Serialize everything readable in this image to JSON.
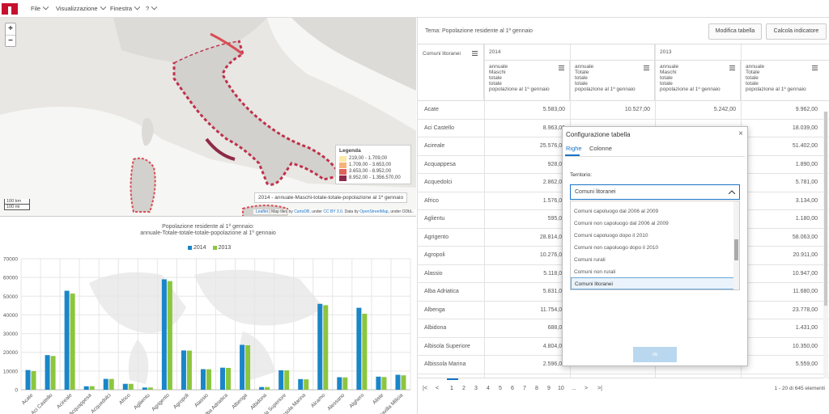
{
  "menu": {
    "items": [
      "File",
      "Visualizzazione",
      "Finestra",
      "?"
    ]
  },
  "map": {
    "zoom_in": "+",
    "zoom_out": "−",
    "legend_title": "Legenda",
    "legend": [
      {
        "label": "219,00 - 1.709,00",
        "color": "#fde9a8"
      },
      {
        "label": "1.709,00 - 3.653,00",
        "color": "#f7b27a"
      },
      {
        "label": "3.653,00 - 8.952,00",
        "color": "#e0625a"
      },
      {
        "label": "8.952,00 - 1.356.570,00",
        "color": "#8e2a4a"
      }
    ],
    "caption": "2014 - annuale-Maschi-totale-totale-popolazione al 1º gennaio",
    "scale_km": "100 km",
    "scale_mi": "100 mi",
    "attribution": {
      "leaflet": "Leaflet",
      "t1": " | Map tiles by ",
      "cartodb": "CartoDB",
      "t2": ", under ",
      "cc": "CC BY 3.0",
      "t3": ". Data by ",
      "osm": "OpenStreetMap",
      "t4": ", under ODbL."
    }
  },
  "chart": {
    "title_line1": "Popolazione residente al 1º gennaio:",
    "title_line2": "annuale-Totale-totale-totale-popolazione al 1º gennaio"
  },
  "chart_data": {
    "type": "bar",
    "title": "Popolazione residente al 1º gennaio: annuale-Totale-totale-totale-popolazione al 1º gennaio",
    "categories": [
      "Acate",
      "Aci Castello",
      "Acireale",
      "Acquappesa",
      "Acquedolci",
      "Africo",
      "Agliientu",
      "Agrigento",
      "Agropoli",
      "Alassio",
      "Alba Adriatica",
      "Albenga",
      "Albidona",
      "Albisola Superiore",
      "Albissola Marina",
      "Alcamo",
      "Alessano",
      "Alghero",
      "Aliste",
      "Altavilla Milicia"
    ],
    "series": [
      {
        "name": "2014",
        "color": "#1a86c8",
        "values": [
          10527,
          18500,
          52900,
          1850,
          5800,
          3150,
          1180,
          59000,
          21000,
          11000,
          11800,
          24000,
          1450,
          10400,
          5700,
          45900,
          6700,
          43800,
          7000,
          8000
        ]
      },
      {
        "name": "2013",
        "color": "#8cc63f",
        "values": [
          9962,
          18039,
          51402,
          1890,
          5781,
          3134,
          1180,
          58063,
          20911,
          10947,
          11680,
          23778,
          1431,
          10350,
          5559,
          45200,
          6600,
          40600,
          6800,
          7700
        ]
      }
    ],
    "ylim": [
      0,
      70000
    ],
    "yticks": [
      0,
      10000,
      20000,
      30000,
      40000,
      50000,
      60000,
      70000
    ],
    "grid": true,
    "legend_position": "top"
  },
  "panel": {
    "tema": "Tema: Popolazione residente al 1º gennaio",
    "btn_modifica": "Modifica tabella",
    "btn_calcola": "Calcola indicatore"
  },
  "table": {
    "row_header": "Comuni litoranei",
    "years": [
      "2014",
      "2013"
    ],
    "col_headers": [
      [
        "annuale",
        "Maschi",
        "totale",
        "totale",
        "popolazione al 1º gennaio"
      ],
      [
        "annuale",
        "Totale",
        "totale",
        "totale",
        "popolazione al 1º gennaio"
      ],
      [
        "annuale",
        "Maschi",
        "totale",
        "totale",
        "popolazione al 1º gennaio"
      ],
      [
        "annuale",
        "Totale",
        "totale",
        "totale",
        "popolazione al 1º gennaio"
      ]
    ],
    "rows": [
      {
        "name": "Acate",
        "v": [
          "5.583,00",
          "10.527,00",
          "5.242,00",
          "9.962,00"
        ]
      },
      {
        "name": "Aci Castello",
        "v": [
          "8.963,00",
          "",
          "",
          "18.039,00"
        ]
      },
      {
        "name": "Acireale",
        "v": [
          "25.576,00",
          "",
          "",
          "51.402,00"
        ]
      },
      {
        "name": "Acquappesa",
        "v": [
          "928,00",
          "",
          "",
          "1.890,00"
        ]
      },
      {
        "name": "Acquedolci",
        "v": [
          "2.862,00",
          "",
          "",
          "5.781,00"
        ]
      },
      {
        "name": "Africo",
        "v": [
          "1.576,00",
          "",
          "",
          "3.134,00"
        ]
      },
      {
        "name": "Aglientu",
        "v": [
          "595,00",
          "",
          "",
          "1.180,00"
        ]
      },
      {
        "name": "Agrigento",
        "v": [
          "28.814,00",
          "",
          "",
          "58.063,00"
        ]
      },
      {
        "name": "Agropoli",
        "v": [
          "10.276,00",
          "",
          "",
          "20.911,00"
        ]
      },
      {
        "name": "Alassio",
        "v": [
          "5.118,00",
          "",
          "",
          "10.947,00"
        ]
      },
      {
        "name": "Alba Adriatica",
        "v": [
          "5.831,00",
          "",
          "",
          "11.680,00"
        ]
      },
      {
        "name": "Albenga",
        "v": [
          "11.754,00",
          "",
          "",
          "23.778,00"
        ]
      },
      {
        "name": "Albidona",
        "v": [
          "688,00",
          "",
          "",
          "1.431,00"
        ]
      },
      {
        "name": "Albisola Superiore",
        "v": [
          "4.804,00",
          "",
          "",
          "10.350,00"
        ]
      },
      {
        "name": "Albissola Marina",
        "v": [
          "2.596,00",
          "5.673,00",
          "2.614,00",
          "5.559,00"
        ]
      }
    ]
  },
  "pager": {
    "pages": [
      "1",
      "2",
      "3",
      "4",
      "5",
      "6",
      "7",
      "8",
      "9",
      "10"
    ],
    "count": "1 - 20 di 645 elementi"
  },
  "dialog": {
    "title": "Configurazione tabella",
    "close": "×",
    "tab_righe": "Righe",
    "tab_colonne": "Colonne",
    "label": "Territorio:",
    "selected": "Comuni litoranei",
    "options": [
      "Comuni capoluogo dal 2006 al 2009",
      "Comuni non capoluogo dal 2006 al 2009",
      "Comuni capoluogo dopo il 2010",
      "Comuni non capoluogo dopo il 2010",
      "Comuni rurali",
      "Comuni non rurali",
      "Comuni litoranei"
    ],
    "ok": "ok"
  }
}
